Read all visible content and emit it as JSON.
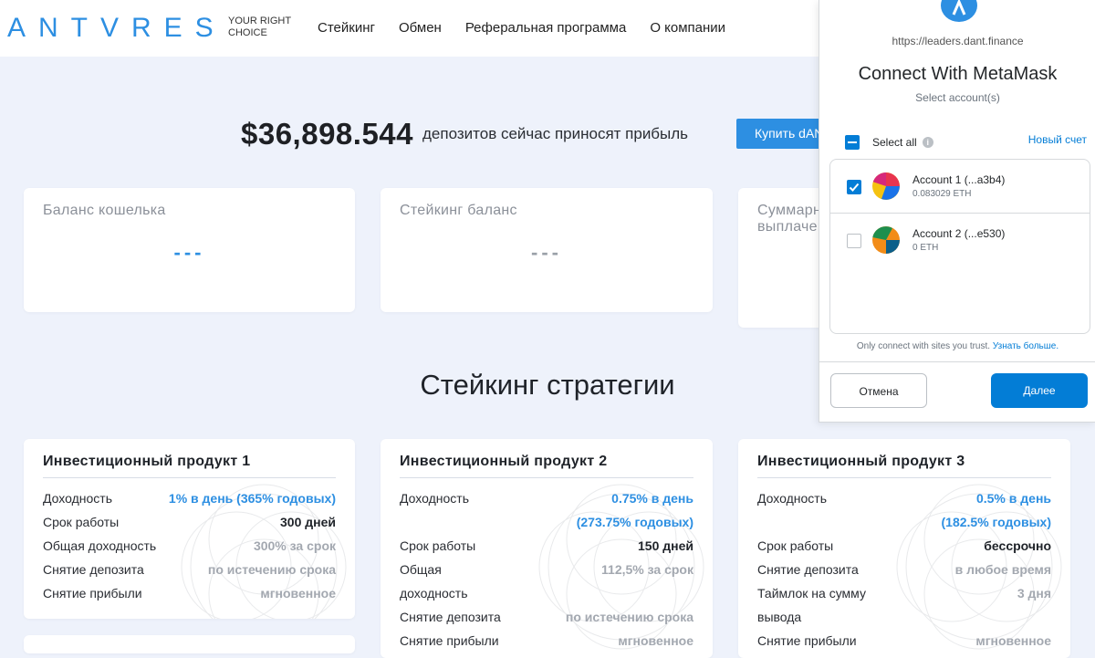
{
  "header": {
    "logo": "ANTVRES",
    "tagline": "YOUR RIGHT CHOICE",
    "nav": [
      "Стейкинг",
      "Обмен",
      "Реферальная программа",
      "О компании"
    ]
  },
  "hero": {
    "amount": "$36,898.544",
    "text": "депозитов сейчас приносят прибыль",
    "buy_button": "Купить dANT"
  },
  "balances": [
    {
      "title": "Баланс кошелька",
      "value": "---",
      "color": "#2d8fe2"
    },
    {
      "title": "Стейкинг баланс",
      "value": "---",
      "color": "#9aa0a8"
    },
    {
      "title": "Суммарно выплачено",
      "value": "",
      "color": "#2d8fe2"
    }
  ],
  "section_title": "Стейкинг стратегии",
  "products": [
    {
      "title": "Инвестиционный продукт 1",
      "rows": [
        {
          "label": "Доходность",
          "value": "1% в день (365% годовых)",
          "style": "blue"
        },
        {
          "label": "Срок работы",
          "value": "300 дней",
          "style": "dark"
        },
        {
          "label": "Общая доходность",
          "value": "300% за срок",
          "style": "gray"
        },
        {
          "label": "Снятие депозита",
          "value": "по истечению срока",
          "style": "gray"
        },
        {
          "label": "Снятие прибыли",
          "value": "мгновенное",
          "style": "gray"
        }
      ]
    },
    {
      "title": "Инвестиционный продукт 2",
      "rows": [
        {
          "label": "Доходность",
          "value": "0.75% в день",
          "style": "blue"
        },
        {
          "label": "",
          "value": "(273.75% годовых)",
          "style": "blue"
        },
        {
          "label": "Срок работы",
          "value": "150 дней",
          "style": "dark"
        },
        {
          "label": "Общая",
          "value": "112,5% за срок",
          "style": "gray"
        },
        {
          "label": "доходность",
          "value": "",
          "style": "gray"
        },
        {
          "label": "Снятие депозита",
          "value": "по истечению срока",
          "style": "gray"
        },
        {
          "label": "Снятие прибыли",
          "value": "мгновенное",
          "style": "gray"
        }
      ]
    },
    {
      "title": "Инвестиционный продукт 3",
      "rows": [
        {
          "label": "Доходность",
          "value": "0.5% в день",
          "style": "blue"
        },
        {
          "label": "",
          "value": "(182.5% годовых)",
          "style": "blue"
        },
        {
          "label": "Срок работы",
          "value": "бессрочно",
          "style": "dark"
        },
        {
          "label": "Снятие депозита",
          "value": "в любое время",
          "style": "gray"
        },
        {
          "label": "Таймлок на сумму",
          "value": "3 дня",
          "style": "gray"
        },
        {
          "label": "вывода",
          "value": "",
          "style": "gray"
        },
        {
          "label": "Снятие прибыли",
          "value": "мгновенное",
          "style": "gray"
        }
      ]
    }
  ],
  "metamask": {
    "url": "https://leaders.dant.finance",
    "title": "Connect With MetaMask",
    "subtitle": "Select account(s)",
    "select_all": "Select all",
    "new_account": "Новый счет",
    "accounts": [
      {
        "name": "Account 1 (...a3b4)",
        "balance": "0.083029 ETH",
        "checked": true
      },
      {
        "name": "Account 2 (...e530)",
        "balance": "0 ETH",
        "checked": false
      }
    ],
    "footer_text": "Only connect with sites you trust.",
    "footer_link": "Узнать больше.",
    "cancel": "Отмена",
    "next": "Далее"
  }
}
